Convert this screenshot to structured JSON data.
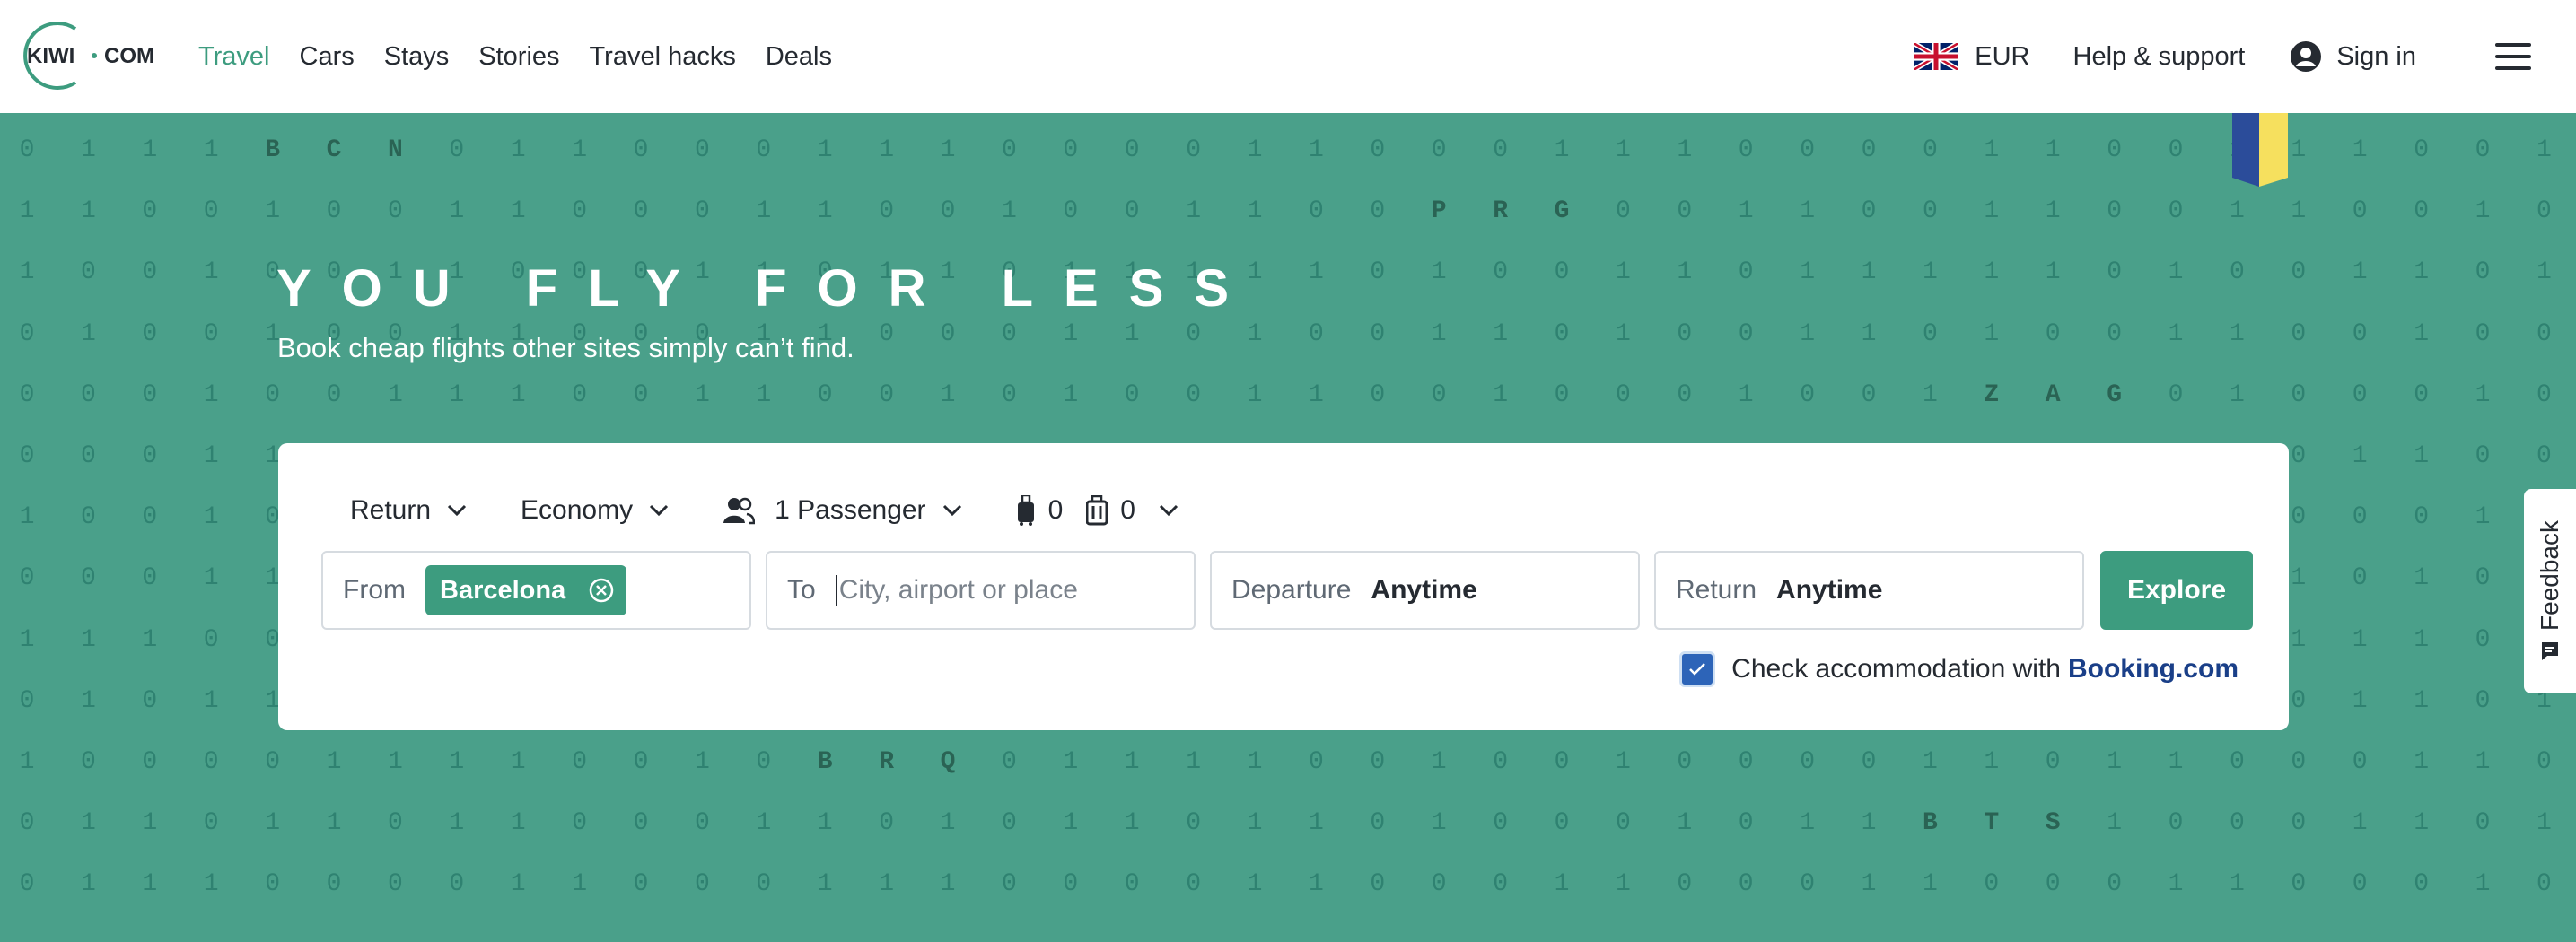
{
  "header": {
    "logo_text_left": "KIWI",
    "logo_text_right": "COM",
    "nav": [
      {
        "label": "Travel",
        "active": true
      },
      {
        "label": "Cars"
      },
      {
        "label": "Stays"
      },
      {
        "label": "Stories"
      },
      {
        "label": "Travel hacks"
      },
      {
        "label": "Deals"
      }
    ],
    "currency": "EUR",
    "help": "Help & support",
    "signin": "Sign in"
  },
  "hero": {
    "title": "YOU FLY FOR LESS",
    "subtitle": "Book cheap flights other sites simply can’t find."
  },
  "search": {
    "trip_type": "Return",
    "cabin": "Economy",
    "passengers": "1 Passenger",
    "cabin_bags": "0",
    "checked_bags": "0",
    "from_label": "From",
    "from_value": "Barcelona",
    "to_label": "To",
    "to_placeholder": "City, airport or place",
    "departure_label": "Departure",
    "departure_value": "Anytime",
    "return_label": "Return",
    "return_value": "Anytime",
    "explore": "Explore",
    "accommodation_text": "Check accommodation with",
    "accommodation_brand": "Booking.com",
    "accommodation_checked": true
  },
  "feedback": "Feedback",
  "background_grid": [
    "0 1 1 1 B C N 0 1 1 0 0 0 1 1 1 0 0 0 0 1 1 0 0 0 1 1 1 0 0 0 0 1 1 0 0 1 1 1 0 0 1 1",
    "1 1 0 0 1 0 0 1 1 0 0 0 1 1 0 0 1 0 0 1 1 0 0 P R G 0 0 1 1 0 0 1 1 0 0 1 1 0 0 1 0",
    "1 0 0 1 0 0 1 1 0 0 0 1 1 0 1 1 0 1 1 1 1 1 0 1 0 0 1 1 0 1 1 1 1 1 0 1 0 0 1 1 0 1",
    "0 1 0 0 1 0 0 1 1 0 0 0 1 1 0 0 0 1 1 0 1 0 0 1 1 0 1 0 0 1 1 0 1 0 0 1 1 0 0 1 0 0",
    "0 0 0 1 0 0 1 1 1 0 0 1 1 0 0 1 0 1 0 0 1 1 0 0 1 0 0 0 1 0 0 1 Z A G 0 1 0 0 0 1 0",
    "0 0 0 1 1 1 1 1 0 0 0 1 1 1 0 0 1 1 0 0 0 1 1 0 0 1 0 0 0 1 1 0 1 1 1 0 0 0 1 1 0 0",
    "1 0 0 1 0 0 1 0 1 0 0 1 0 1 1 0 0 1 1 1 0 1 1 0 0 1 1 0 0 1 0 0 1 1 0 0 1 0 0 0 1 1",
    "0 0 0 1 1 0 1 1 1 0 1 1 0 1 0 0 1 1 0 0 1 1 0 0 1 0 0 1 1 1 0 1 1 0 1 1 0 1 0 1 0 0",
    "1 1 1 0 0 1 1 0 1 0 0 1 1 0 0 1 1 1 0 0 1 0 0 1 1 0 0 1 1 0 1 0 0 1 1 0 0 1 1 1 0 1",
    "0 1 0 1 1 0 1 1 0 0 0 1 1 0 1 1 0 0 1 1 0 0 0 1 1 0 1 1 0 0 1 1 0 0 0 1 1 0 1 1 0 1",
    "1 0 0 0 0 1 1 1 1 0 0 1 0 B R Q 0 1 1 1 1 0 0 1 0 0 1 0 0 0 0 1 1 0 1 1 0 0 0 1 1 0 0",
    "0 1 1 0 1 1 0 1 1 0 0 0 1 1 0 1 0 1 1 0 1 1 0 1 0 0 0 1 0 1 1 B T S 1 0 0 0 1 1 0 1 1",
    "0 1 1 1 0 0 0 0 1 1 0 0 0 1 1 1 0 0 0 0 1 1 0 0 0 1 1 0 0 0 1 1 0 0 0 1 1 0 0 0 1 0"
  ]
}
